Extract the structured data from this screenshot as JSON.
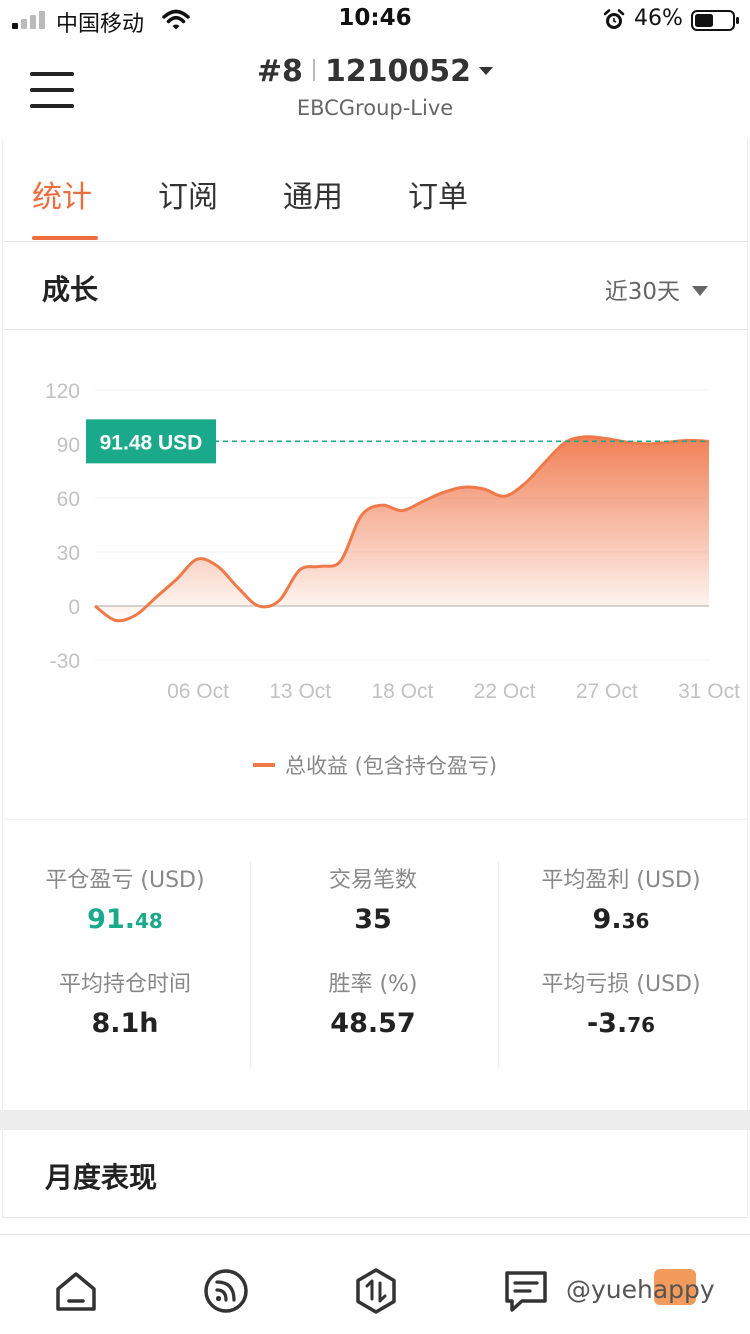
{
  "status_bar": {
    "carrier": "中国移动",
    "time": "10:46",
    "battery": "46%",
    "icons": [
      "signal-icon",
      "wifi-icon",
      "alarm-icon",
      "battery-icon"
    ]
  },
  "header": {
    "account_no": "#8",
    "account_id": "1210052",
    "server": "EBCGroup-Live"
  },
  "tabs": [
    {
      "label": "统计",
      "active": true
    },
    {
      "label": "订阅",
      "active": false
    },
    {
      "label": "通用",
      "active": false
    },
    {
      "label": "订单",
      "active": false
    }
  ],
  "growth": {
    "title": "成长",
    "range": "近30天"
  },
  "chart_data": {
    "type": "area",
    "ylim": [
      -30,
      120
    ],
    "yticks": [
      "120",
      "90",
      "60",
      "30",
      "0",
      "-30"
    ],
    "xtick_labels": [
      "06 Oct",
      "13 Oct",
      "18 Oct",
      "22 Oct",
      "27 Oct",
      "31 Oct"
    ],
    "current_label": "91.48 USD",
    "current_value": 91.48,
    "series": [
      {
        "name": "总收益 (包含持仓盈亏)",
        "color": "#ee7a4a",
        "x": [
          0,
          1,
          2,
          3,
          4,
          5,
          6,
          7,
          8,
          9,
          10,
          11,
          12,
          13,
          14,
          15,
          16,
          17,
          18,
          19,
          20,
          21,
          22,
          23,
          24,
          25,
          26,
          27,
          28,
          29,
          30
        ],
        "values": [
          0,
          -8,
          -5,
          5,
          15,
          26,
          22,
          10,
          0,
          3,
          20,
          22,
          25,
          50,
          56,
          53,
          58,
          63,
          66,
          65,
          61,
          68,
          80,
          91,
          94,
          93,
          91,
          90,
          91,
          92,
          91.48
        ]
      }
    ]
  },
  "legend": {
    "label": "总收益 (包含持仓盈亏)"
  },
  "stats": {
    "closed_pl": {
      "label": "平仓盈亏 (USD)",
      "int": "91.",
      "dec": "48"
    },
    "trades": {
      "label": "交易笔数",
      "value": "35"
    },
    "avg_profit": {
      "label": "平均盈利 (USD)",
      "int": "9.",
      "dec": "36"
    },
    "avg_hold": {
      "label": "平均持仓时间",
      "value": "8.1h"
    },
    "win_rate": {
      "label": "胜率 (%)",
      "value": "48.57"
    },
    "avg_loss": {
      "label": "平均亏损 (USD)",
      "int": "-3.",
      "dec": "76"
    }
  },
  "monthly": {
    "title": "月度表现"
  },
  "bottom_nav": {
    "items": [
      "home-icon",
      "signal-feed-icon",
      "trade-icon",
      "orders-icon"
    ],
    "watermark": "@yuehappy"
  },
  "colors": {
    "accent": "#ee6d3f",
    "green": "#1aa98a",
    "line": "#ee7a4a"
  }
}
